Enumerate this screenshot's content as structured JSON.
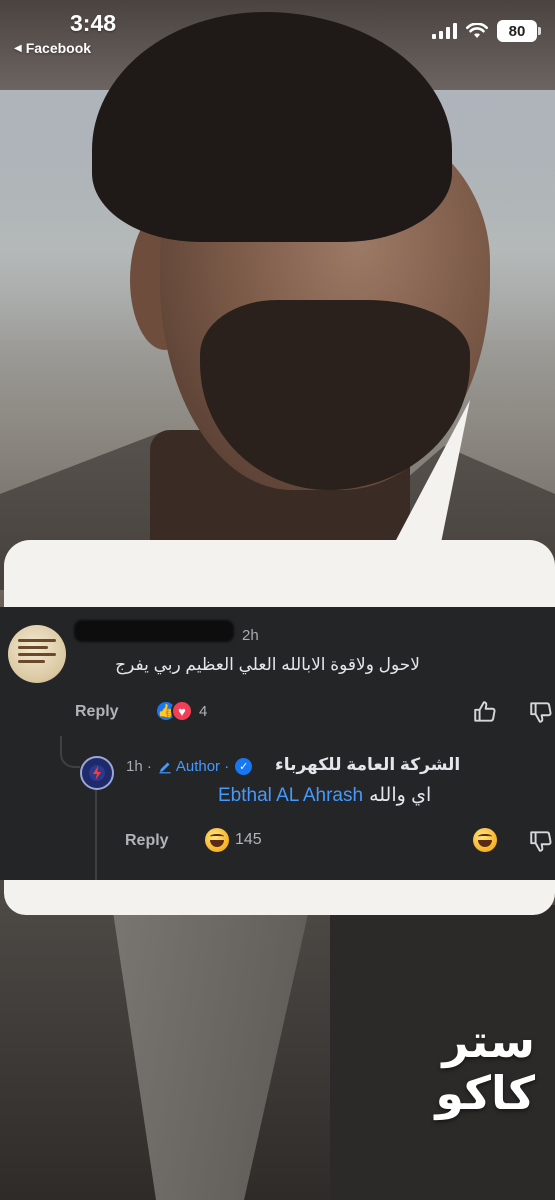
{
  "status_bar": {
    "time": "3:48",
    "back_label": "Facebook",
    "battery": "80"
  },
  "main_comment": {
    "time_ago": "2h",
    "text": "لاحول ولاقوة الابالله العلي العظيم ربي يفرج",
    "reply_label": "Reply",
    "reaction_count": "4"
  },
  "reply_comment": {
    "time_ago": "1h ·",
    "author_label": "Author ·",
    "name": "الشركة العامة للكهرباء",
    "mention": "Ebthal AL Ahrash",
    "text": "اي والله",
    "reply_label": "Reply",
    "reaction_count": "145"
  },
  "watermark": {
    "line1": "ستر",
    "line2": "كاكو"
  }
}
